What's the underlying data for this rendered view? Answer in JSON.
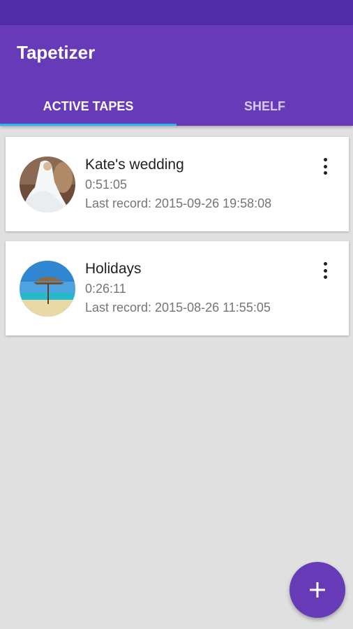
{
  "app": {
    "title": "Tapetizer"
  },
  "tabs": [
    {
      "label": "ACTIVE TAPES",
      "active": true
    },
    {
      "label": "SHELF",
      "active": false
    }
  ],
  "tapes": [
    {
      "title": "Kate's wedding",
      "duration": "0:51:05",
      "last_record": "Last record: 2015-09-26 19:58:08",
      "thumbnail": "wedding-dress-photo"
    },
    {
      "title": "Holidays",
      "duration": "0:26:11",
      "last_record": "Last record: 2015-08-26 11:55:05",
      "thumbnail": "beach-umbrella-photo"
    }
  ],
  "colors": {
    "primary": "#673ab7",
    "primary_dark": "#512da8",
    "tab_indicator": "#29b6f6",
    "background": "#e0e0e0"
  },
  "icons": {
    "item_menu": "more-vert-icon",
    "fab": "plus-icon"
  }
}
